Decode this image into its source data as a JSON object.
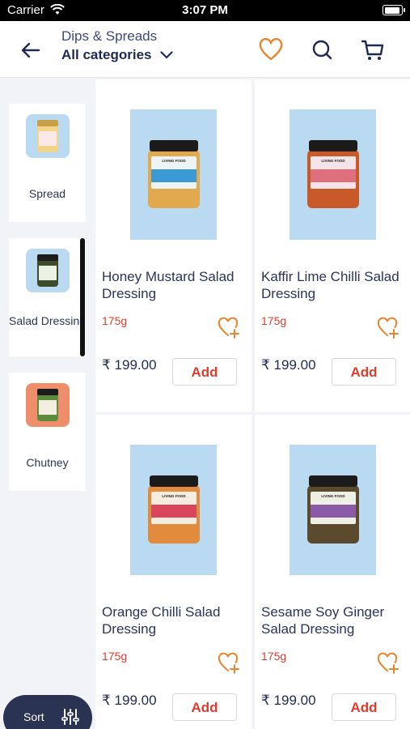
{
  "status_bar": {
    "carrier": "Carrier",
    "time": "3:07 PM"
  },
  "header": {
    "section_title": "Dips & Spreads",
    "category_selector": "All categories",
    "icons": [
      "back-arrow-icon",
      "heart-icon",
      "search-icon",
      "cart-icon"
    ],
    "accent_color": "#e8852f"
  },
  "sidebar": {
    "items": [
      {
        "label": "Spread",
        "thumb_color": "#b9daf0",
        "active": false
      },
      {
        "label": "Salad Dressing",
        "thumb_color": "#b9daf0",
        "active": true
      },
      {
        "label": "Chutney",
        "thumb_color": "#ef8e6a",
        "active": false
      }
    ]
  },
  "products": [
    {
      "name": "Honey Mustard Salad Dressing",
      "weight": "175g",
      "price": "₹ 199.00",
      "add_label": "Add",
      "jar_color": "#e2a94e",
      "label_color": "#3b9ad3"
    },
    {
      "name": "Kaffir Lime Chilli Salad Dressing",
      "weight": "175g",
      "price": "₹ 199.00",
      "add_label": "Add",
      "jar_color": "#c85a2a",
      "label_color": "#e06f7d"
    },
    {
      "name": "Orange Chilli Salad Dressing",
      "weight": "175g",
      "price": "₹ 199.00",
      "add_label": "Add",
      "jar_color": "#e28b3c",
      "label_color": "#d9465b"
    },
    {
      "name": "Sesame Soy Ginger Salad Dressing",
      "weight": "175g",
      "price": "₹ 199.00",
      "add_label": "Add",
      "jar_color": "#5b4a2e",
      "label_color": "#8a5aa8"
    }
  ],
  "sort": {
    "label": "Sort"
  },
  "colors": {
    "price_red": "#e03b2b",
    "navy": "#2b3352",
    "image_bg": "#b9daf0"
  }
}
